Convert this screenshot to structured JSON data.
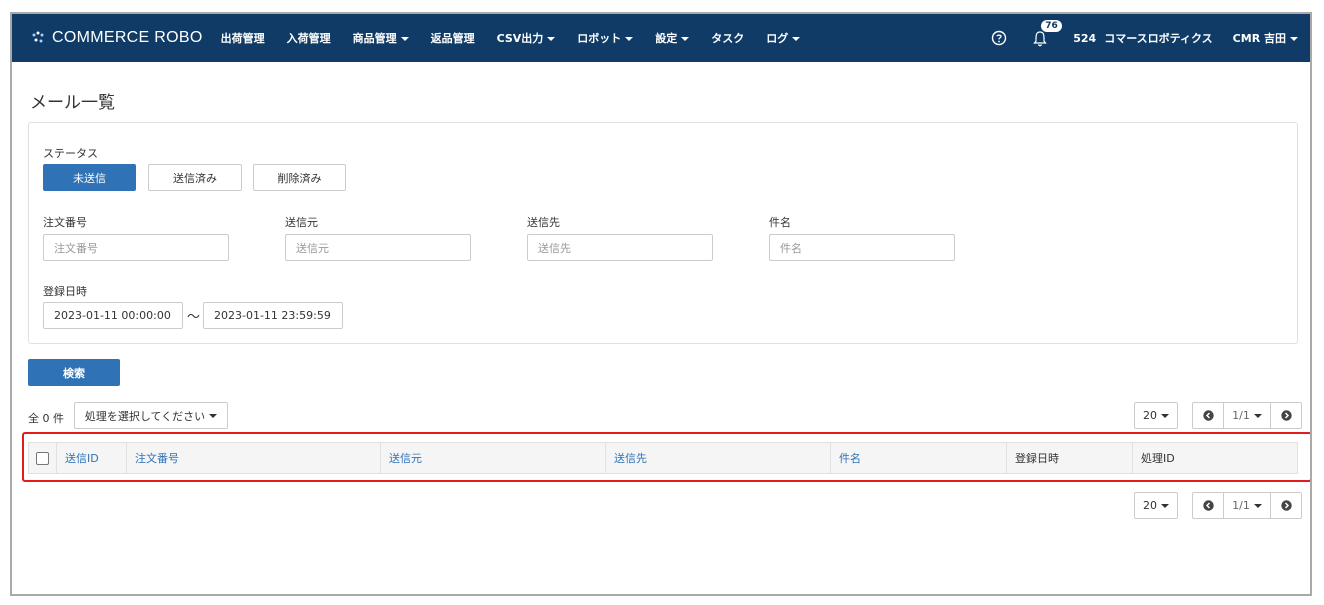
{
  "brand": {
    "name": "COMMERCE ROBO"
  },
  "nav": {
    "items": [
      "出荷管理",
      "入荷管理",
      "商品管理",
      "返品管理",
      "CSV出力",
      "ロボット",
      "設定",
      "タスク",
      "ログ"
    ],
    "dropdown_flags": [
      false,
      false,
      true,
      false,
      true,
      true,
      true,
      false,
      true
    ],
    "help_icon": "question-circle-icon",
    "notification_count": "76",
    "store_id": "524",
    "store_name": "コマースロボティクス",
    "user_name": "CMR 吉田"
  },
  "page": {
    "title": "メール一覧"
  },
  "filters": {
    "status_label": "ステータス",
    "status_buttons": [
      "未送信",
      "送信済み",
      "削除済み"
    ],
    "active_status_index": 0,
    "fields": [
      {
        "label": "注文番号",
        "placeholder": "注文番号"
      },
      {
        "label": "送信元",
        "placeholder": "送信元"
      },
      {
        "label": "送信先",
        "placeholder": "送信先"
      },
      {
        "label": "件名",
        "placeholder": "件名"
      }
    ],
    "date_label": "登録日時",
    "date_from": "2023-01-11 00:00:00",
    "date_to": "2023-01-11 23:59:59",
    "date_sep": "〜"
  },
  "search_button": "検索",
  "results": {
    "total_text": "全 0 件",
    "action_select": "処理を選択してください"
  },
  "pagination": {
    "per_page": "20",
    "page_text": "1/1"
  },
  "table": {
    "columns": [
      "送信ID",
      "注文番号",
      "送信元",
      "送信先",
      "件名",
      "登録日時",
      "処理ID"
    ],
    "sortable": [
      true,
      true,
      true,
      true,
      true,
      false,
      false
    ]
  },
  "colors": {
    "navbar": "#0f3b66",
    "primary": "#2f73b6",
    "highlight": "#e01c1c"
  }
}
